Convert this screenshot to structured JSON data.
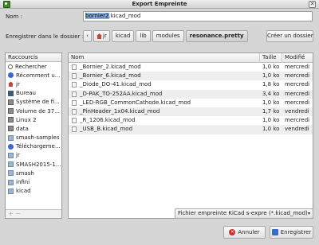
{
  "window": {
    "title": "Export Empreinte",
    "close_glyph": "✕"
  },
  "name_field": {
    "label": "Nom :",
    "value_selected": "bornier2",
    "value_rest": ".kicad_mod"
  },
  "folder": {
    "label": "Enregistrer dans le dossier :",
    "back_glyph": "‹",
    "crumbs": [
      "jr",
      "kicad",
      "lib",
      "modules",
      "resonance.pretty"
    ],
    "create_label": "Créer un dossier"
  },
  "places": {
    "header": "Raccourcis",
    "items": [
      {
        "label": "Rechercher",
        "icon": "search-icon"
      },
      {
        "label": "Récemment u...",
        "icon": "recent-icon"
      },
      {
        "label": "jr",
        "icon": "home-icon"
      },
      {
        "label": "Bureau",
        "icon": "desktop-icon"
      },
      {
        "label": "Système de fi...",
        "icon": "drive-icon"
      },
      {
        "label": "Volume de 37...",
        "icon": "drive-icon"
      },
      {
        "label": "Linux 2",
        "icon": "drive-icon"
      },
      {
        "label": "data",
        "icon": "drive-icon"
      },
      {
        "label": "smash-samples",
        "icon": "folder-icon"
      },
      {
        "label": "Téléchargeme...",
        "icon": "download-icon"
      },
      {
        "label": "jr",
        "icon": "folder-icon"
      },
      {
        "label": "SMASH2015-1...",
        "icon": "folder-icon"
      },
      {
        "label": "smash",
        "icon": "folder-icon"
      },
      {
        "label": "infini",
        "icon": "folder-icon"
      },
      {
        "label": "kicad",
        "icon": "folder-icon"
      }
    ],
    "footer": "+ −"
  },
  "files": {
    "columns": {
      "name": "Nom",
      "size": "Taille",
      "modified": "Modifié"
    },
    "rows": [
      {
        "name": "_Bornier_2.kicad_mod",
        "size": "1,0 ko",
        "modified": "mercredi"
      },
      {
        "name": "_Bornier_6.kicad_mod",
        "size": "1,0 ko",
        "modified": "mercredi"
      },
      {
        "name": "_Diode_DO-41.kicad_mod",
        "size": "1,8 ko",
        "modified": "mercredi"
      },
      {
        "name": "_D-PAK_TO-252AA.kicad_mod",
        "size": "3,4 ko",
        "modified": "mercredi"
      },
      {
        "name": "_LED-RGB_CommonCathode.kicad_mod",
        "size": "1,0 ko",
        "modified": "mercredi"
      },
      {
        "name": "_PinHeader_1x04.kicad_mod",
        "size": "1,7 ko",
        "modified": "vendredi"
      },
      {
        "name": "_R_1206.kicad_mod",
        "size": "1,0 ko",
        "modified": "mercredi"
      },
      {
        "name": "_USB_B.kicad_mod",
        "size": "1,0 ko",
        "modified": "vendredi"
      }
    ]
  },
  "filter": {
    "value": "Fichier empreinte KiCad s-expre  (*.kicad_mod)",
    "chevron": "▾"
  },
  "buttons": {
    "cancel": "Annuler",
    "save": "Enregistrer",
    "cancel_glyph": "×"
  }
}
